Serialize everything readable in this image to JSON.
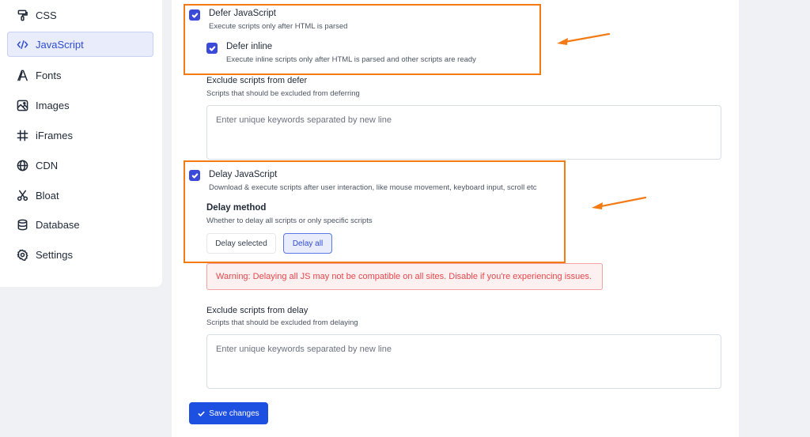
{
  "sidebar": {
    "items": [
      {
        "label": "CSS",
        "icon": "paint-roller-icon",
        "active": false
      },
      {
        "label": "JavaScript",
        "icon": "code-icon",
        "active": true
      },
      {
        "label": "Fonts",
        "icon": "font-icon",
        "active": false
      },
      {
        "label": "Images",
        "icon": "image-icon",
        "active": false
      },
      {
        "label": "iFrames",
        "icon": "hash-icon",
        "active": false
      },
      {
        "label": "CDN",
        "icon": "globe-icon",
        "active": false
      },
      {
        "label": "Bloat",
        "icon": "scissors-icon",
        "active": false
      },
      {
        "label": "Database",
        "icon": "database-icon",
        "active": false
      },
      {
        "label": "Settings",
        "icon": "gear-icon",
        "active": false
      }
    ]
  },
  "main": {
    "defer_js": {
      "title": "Defer JavaScript",
      "description": "Execute scripts only after HTML is parsed",
      "checked": true
    },
    "defer_inline": {
      "title": "Defer inline",
      "description": "Execute inline scripts only after HTML is parsed and other scripts are ready",
      "checked": true
    },
    "exclude_defer": {
      "label": "Exclude scripts from defer",
      "description": "Scripts that should be excluded from deferring",
      "placeholder": "Enter unique keywords separated by new line",
      "value": ""
    },
    "delay_js": {
      "title": "Delay JavaScript",
      "description": "Download & execute scripts after user interaction, like mouse movement, keyboard input, scroll etc",
      "checked": true
    },
    "delay_method": {
      "label": "Delay method",
      "description": "Whether to delay all scripts or only specific scripts",
      "options": [
        "Delay selected",
        "Delay all"
      ],
      "selected": "Delay all"
    },
    "warning": "Warning: Delaying all JS may not be compatible on all sites. Disable if you're experiencing issues.",
    "exclude_delay": {
      "label": "Exclude scripts from delay",
      "description": "Scripts that should be excluded from delaying",
      "placeholder": "Enter unique keywords separated by new line",
      "value": ""
    },
    "save_label": "Save changes"
  },
  "annotations": {
    "color": "#f47a14"
  }
}
